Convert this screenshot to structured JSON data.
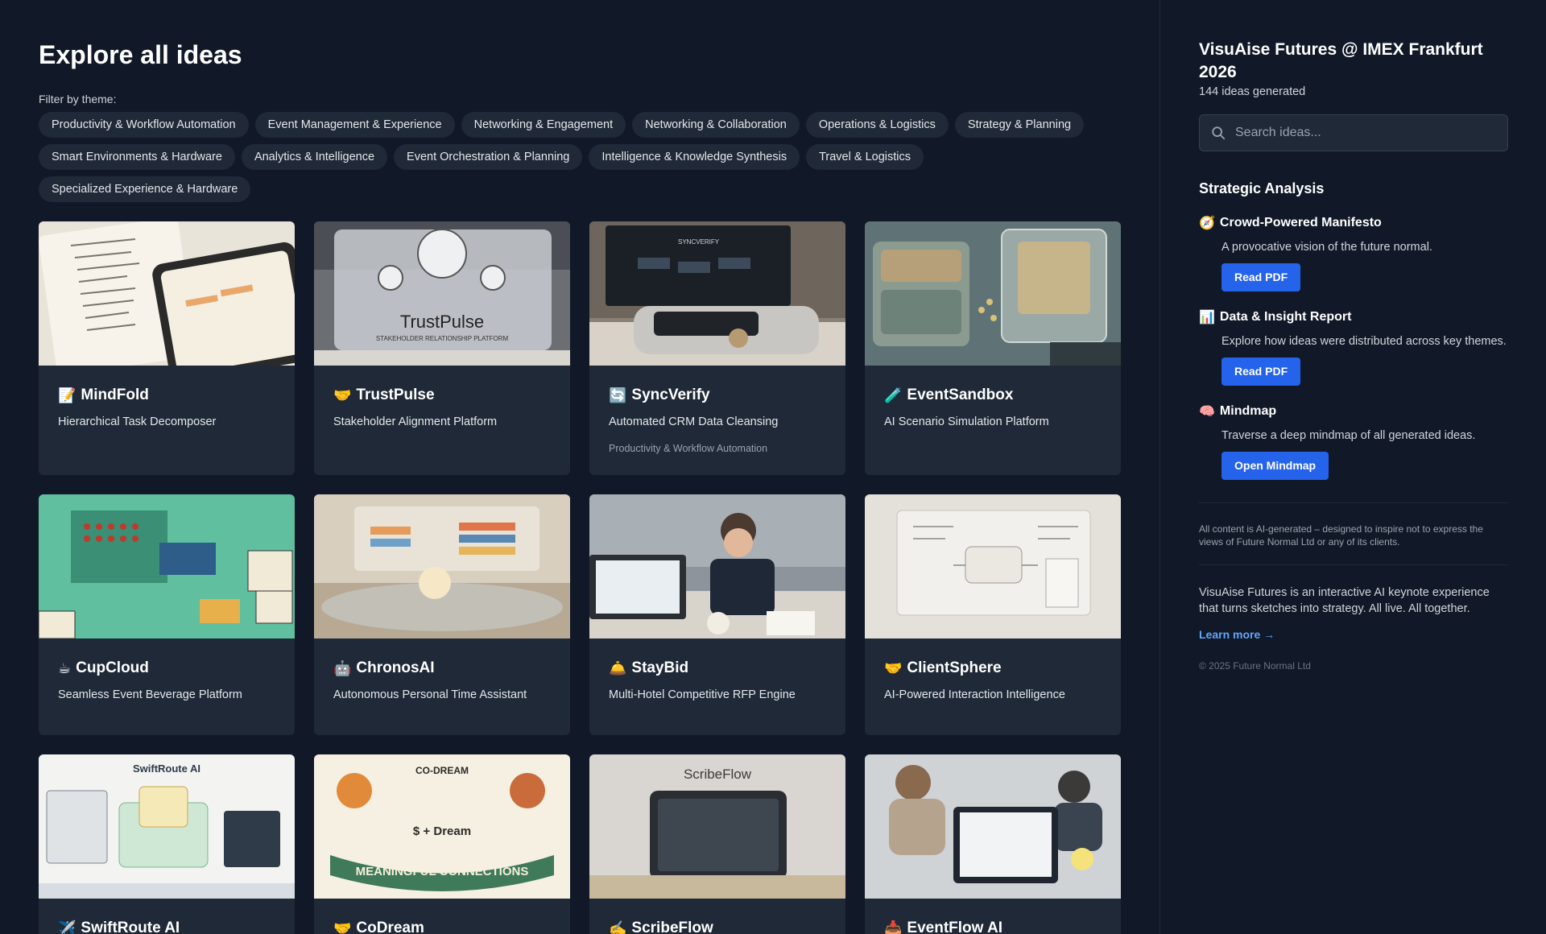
{
  "main": {
    "title": "Explore all ideas",
    "filter_label": "Filter by theme:",
    "themes": [
      "Productivity & Workflow Automation",
      "Event Management & Experience",
      "Networking & Engagement",
      "Networking & Collaboration",
      "Operations & Logistics",
      "Strategy & Planning",
      "Smart Environments & Hardware",
      "Analytics & Intelligence",
      "Event Orchestration & Planning",
      "Intelligence & Knowledge Synthesis",
      "Travel & Logistics",
      "Specialized Experience & Hardware"
    ],
    "cards": [
      {
        "emoji": "📝",
        "title": "MindFold",
        "subtitle": "Hierarchical Task Decomposer",
        "theme": ""
      },
      {
        "emoji": "🤝",
        "title": "TrustPulse",
        "subtitle": "Stakeholder Alignment Platform",
        "theme": ""
      },
      {
        "emoji": "🔄",
        "title": "SyncVerify",
        "subtitle": "Automated CRM Data Cleansing",
        "theme": "Productivity & Workflow Automation"
      },
      {
        "emoji": "🧪",
        "title": "EventSandbox",
        "subtitle": "AI Scenario Simulation Platform",
        "theme": ""
      },
      {
        "emoji": "☕",
        "title": "CupCloud",
        "subtitle": "Seamless Event Beverage Platform",
        "theme": ""
      },
      {
        "emoji": "🤖",
        "title": "ChronosAI",
        "subtitle": "Autonomous Personal Time Assistant",
        "theme": ""
      },
      {
        "emoji": "🛎️",
        "title": "StayBid",
        "subtitle": "Multi-Hotel Competitive RFP Engine",
        "theme": ""
      },
      {
        "emoji": "🤝",
        "title": "ClientSphere",
        "subtitle": "AI-Powered Interaction Intelligence",
        "theme": ""
      },
      {
        "emoji": "✈️",
        "title": "SwiftRoute AI",
        "subtitle": "",
        "theme": ""
      },
      {
        "emoji": "🤝",
        "title": "CoDream",
        "subtitle": "",
        "theme": ""
      },
      {
        "emoji": "✍️",
        "title": "ScribeFlow",
        "subtitle": "",
        "theme": ""
      },
      {
        "emoji": "📥",
        "title": "EventFlow AI",
        "subtitle": "",
        "theme": ""
      }
    ],
    "thumb_text": {
      "trustpulse_name": "TrustPulse",
      "trustpulse_tag": "STAKEHOLDER RELATIONSHIP PLATFORM",
      "swiftroute_name": "SwiftRoute AI",
      "codream_banner": "MEANINGFUL CONNECTIONS",
      "codream_mid": "$ + Dream",
      "codream_top": "CO-DREAM",
      "scribeflow_name": "ScribeFlow",
      "syncverify_name": "SYNCVERIFY"
    }
  },
  "sidebar": {
    "title": "VisuAise Futures @ IMEX Frankfurt 2026",
    "count": "144 ideas generated",
    "search_placeholder": "Search ideas...",
    "analysis_heading": "Strategic Analysis",
    "items": [
      {
        "emoji": "🧭",
        "title": "Crowd-Powered Manifesto",
        "desc": "A provocative vision of the future normal.",
        "button": "Read PDF"
      },
      {
        "emoji": "📊",
        "title": "Data & Insight Report",
        "desc": "Explore how ideas were distributed across key themes.",
        "button": "Read PDF"
      },
      {
        "emoji": "🧠",
        "title": "Mindmap",
        "desc": "Traverse a deep mindmap of all generated ideas.",
        "button": "Open Mindmap"
      }
    ],
    "disclaimer": "All content is AI-generated – designed to inspire not to express the views of Future Normal Ltd or any of its clients.",
    "about": "VisuAise Futures is an interactive AI keynote experience that turns sketches into strategy. All live. All together.",
    "learn_more": "Learn more →",
    "copyright": "© 2025 Future Normal Ltd"
  },
  "colors": {
    "background": "#111827",
    "card": "#1f2937",
    "accent": "#2563eb",
    "link": "#60a5fa"
  }
}
